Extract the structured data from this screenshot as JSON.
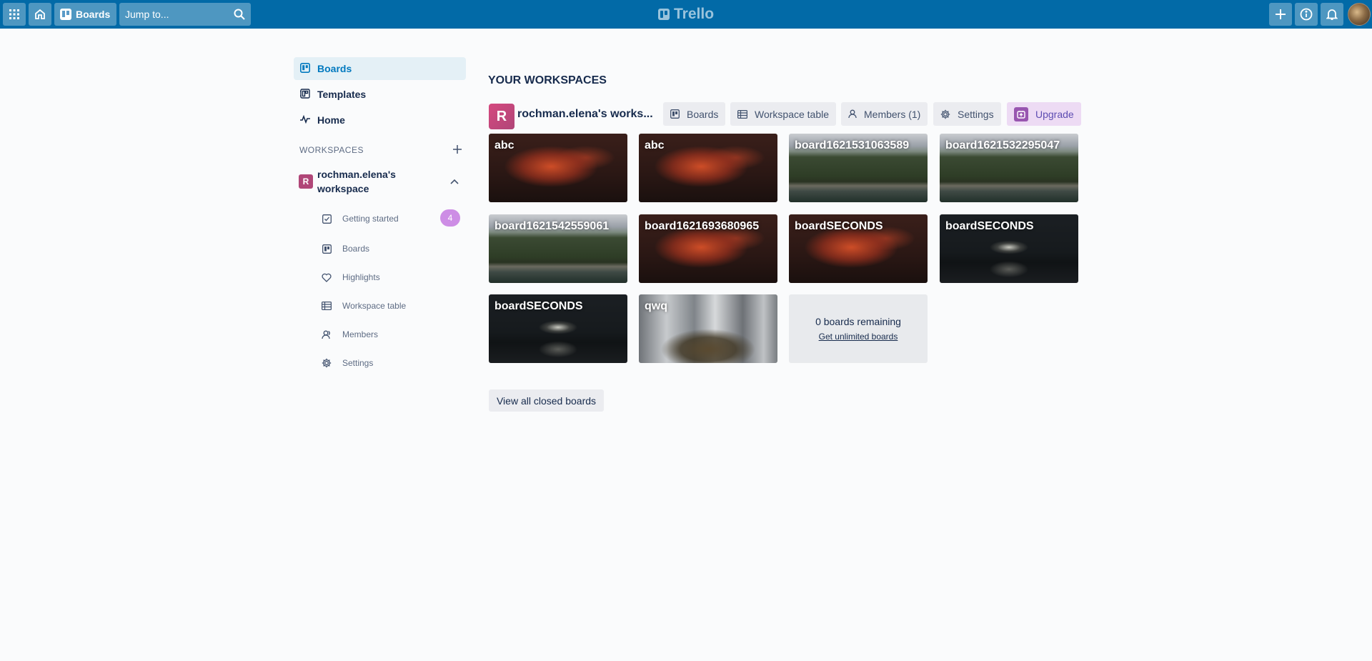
{
  "header": {
    "boards_label": "Boards",
    "search_placeholder": "Jump to...",
    "logo_text": "Trello",
    "bar_color": "#026aa7"
  },
  "sidebar": {
    "nav": [
      {
        "label": "Boards",
        "icon": "board-icon",
        "active": true
      },
      {
        "label": "Templates",
        "icon": "template-icon",
        "active": false
      },
      {
        "label": "Home",
        "icon": "activity-icon",
        "active": false
      }
    ],
    "workspaces_heading": "WORKSPACES",
    "workspace": {
      "initial": "R",
      "name": "rochman.elena's workspace",
      "badge_color": "#b04678",
      "items": [
        {
          "label": "Getting started",
          "icon": "checklist-icon",
          "count": "4"
        },
        {
          "label": "Boards",
          "icon": "board-icon"
        },
        {
          "label": "Highlights",
          "icon": "heart-icon"
        },
        {
          "label": "Workspace table",
          "icon": "table-icon"
        },
        {
          "label": "Members",
          "icon": "members-icon"
        },
        {
          "label": "Settings",
          "icon": "gear-icon"
        }
      ]
    }
  },
  "main": {
    "section_title": "YOUR WORKSPACES",
    "workspace": {
      "initial": "R",
      "title": "rochman.elena's works...",
      "tabs": [
        {
          "label": "Boards",
          "icon": "board-icon"
        },
        {
          "label": "Workspace table",
          "icon": "table-icon"
        },
        {
          "label": "Members (1)",
          "icon": "person-icon"
        },
        {
          "label": "Settings",
          "icon": "gear-icon"
        },
        {
          "label": "Upgrade",
          "icon": "upgrade-icon"
        }
      ]
    },
    "boards": [
      {
        "name": "abc",
        "background": "cloud"
      },
      {
        "name": "abc",
        "background": "cloud"
      },
      {
        "name": "board1621531063589",
        "background": "forest"
      },
      {
        "name": "board1621532295047",
        "background": "forest"
      },
      {
        "name": "board1621542559061",
        "background": "forest"
      },
      {
        "name": "board1621693680965",
        "background": "cloud"
      },
      {
        "name": "boardSECONDS",
        "background": "cloud"
      },
      {
        "name": "boardSECONDS",
        "background": "cabin"
      },
      {
        "name": "boardSECONDS",
        "background": "cabin"
      },
      {
        "name": "qwq",
        "background": "waterfall"
      }
    ],
    "remaining": {
      "text": "0 boards remaining",
      "link": "Get unlimited boards"
    },
    "closed_boards_label": "View all closed boards"
  }
}
